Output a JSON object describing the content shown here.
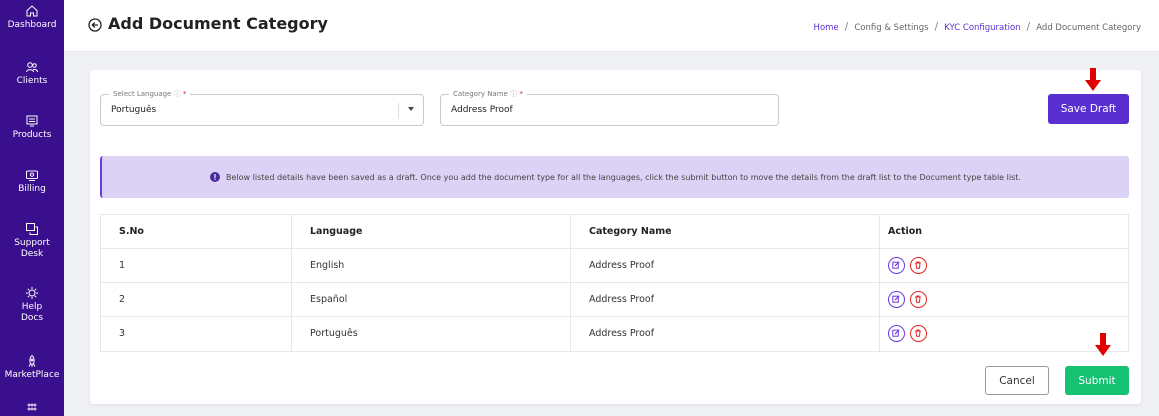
{
  "sidebar": {
    "items": [
      {
        "label": "Dashboard",
        "icon": "home-icon"
      },
      {
        "label": "Clients",
        "icon": "users-icon"
      },
      {
        "label": "Products",
        "icon": "products-icon"
      },
      {
        "label": "Billing",
        "icon": "billing-icon"
      },
      {
        "label": "Support Desk",
        "icon": "support-icon"
      },
      {
        "label": "Help Docs",
        "icon": "help-icon"
      },
      {
        "label": "MarketPlace",
        "icon": "rocket-icon"
      }
    ]
  },
  "header": {
    "title": "Add Document Category",
    "breadcrumb": [
      "Home",
      "Config & Settings",
      "KYC Configuration",
      "Add Document Category"
    ]
  },
  "form": {
    "language": {
      "label": "Select Language",
      "required_mark": "*",
      "value": "Português"
    },
    "category": {
      "label": "Category Name",
      "required_mark": "*",
      "value": "Address Proof"
    },
    "save_draft_label": "Save Draft"
  },
  "alert": {
    "text": "Below listed details have been saved as a draft. Once you add the document type for all the languages, click the submit button to move the details from the draft list to the Document type table list."
  },
  "table": {
    "headers": [
      "S.No",
      "Language",
      "Category Name",
      "Action"
    ],
    "rows": [
      {
        "sno": "1",
        "language": "English",
        "category": "Address Proof"
      },
      {
        "sno": "2",
        "language": "Español",
        "category": "Address Proof"
      },
      {
        "sno": "3",
        "language": "Português",
        "category": "Address Proof"
      }
    ]
  },
  "footer": {
    "cancel_label": "Cancel",
    "submit_label": "Submit"
  },
  "colors": {
    "sidebar": "#3a0f8e",
    "primary": "#5a2fd0",
    "success": "#16c172",
    "danger": "#e02424",
    "alert_bg": "#dcd2f5",
    "annotation_arrow": "#e00000"
  }
}
